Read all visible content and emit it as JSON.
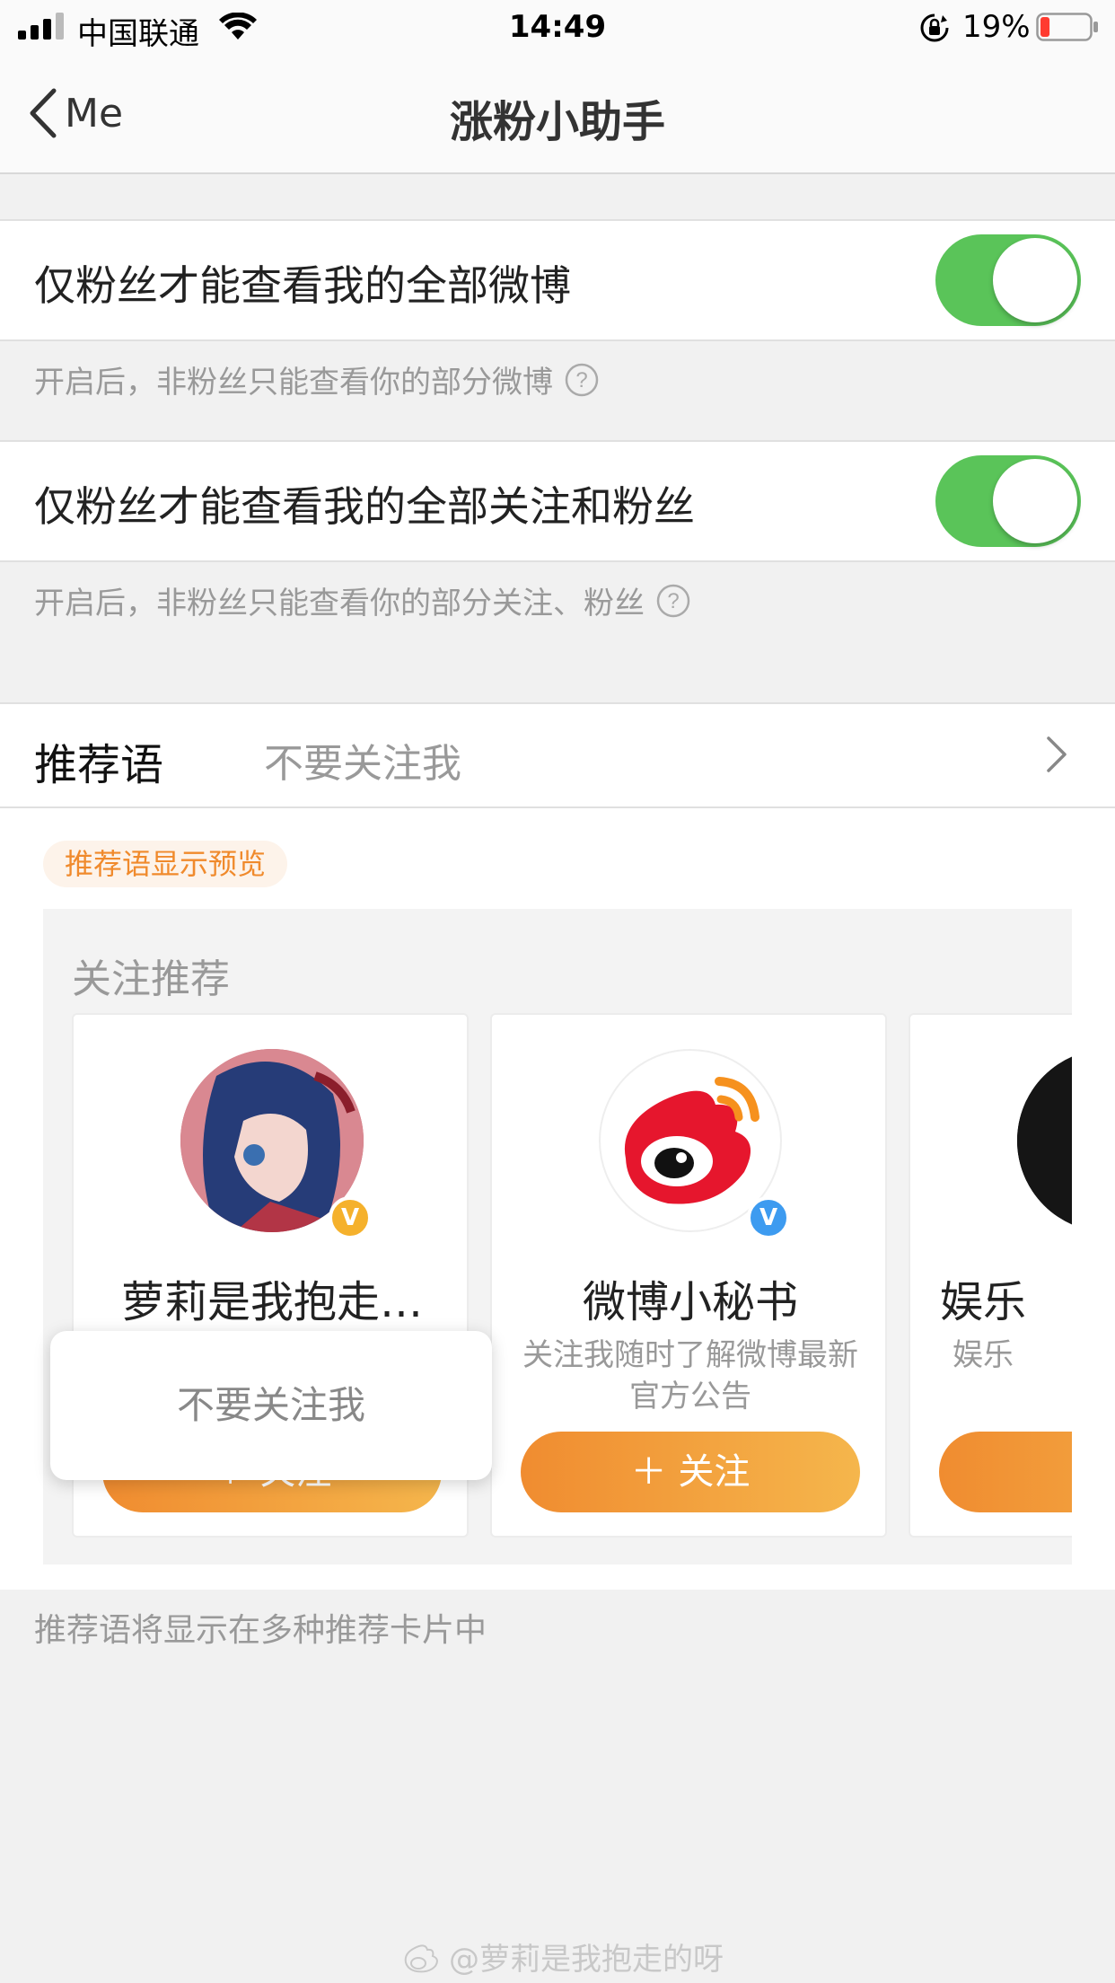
{
  "status_bar": {
    "carrier": "中国联通",
    "time": "14:49",
    "battery_percent": "19%",
    "battery_level": 0.19,
    "battery_color": "#ff3b30"
  },
  "nav": {
    "back_label": "Me",
    "title": "涨粉小助手"
  },
  "settings": {
    "row1": {
      "label": "仅粉丝才能查看我的全部微博",
      "toggle_on": true,
      "hint": "开启后，非粉丝只能查看你的部分微博"
    },
    "row2": {
      "label": "仅粉丝才能查看我的全部关注和粉丝",
      "toggle_on": true,
      "hint": "开启后，非粉丝只能查看你的部分关注、粉丝"
    },
    "recommend": {
      "label": "推荐语",
      "value": "不要关注我"
    }
  },
  "preview": {
    "chip": "推荐语显示预览",
    "heading": "关注推荐",
    "cards": [
      {
        "name": "萝莉是我抱走…",
        "desc": "",
        "button": "＋ 关注",
        "badge": "V",
        "badge_color": "#f5b12c"
      },
      {
        "name": "微博小秘书",
        "desc": "关注我随时了解微博最新官方公告",
        "button": "＋ 关注",
        "badge": "V",
        "badge_color": "#3d9bf0"
      },
      {
        "name": "娱乐",
        "desc": "娱乐",
        "button": "＋",
        "badge": "",
        "badge_color": ""
      }
    ],
    "popup_text": "不要关注我"
  },
  "footer_note": "推荐语将显示在多种推荐卡片中",
  "watermark": "@萝莉是我抱走的呀",
  "colors": {
    "toggle_on": "#5ac459",
    "accent_orange": "#f08c30"
  }
}
